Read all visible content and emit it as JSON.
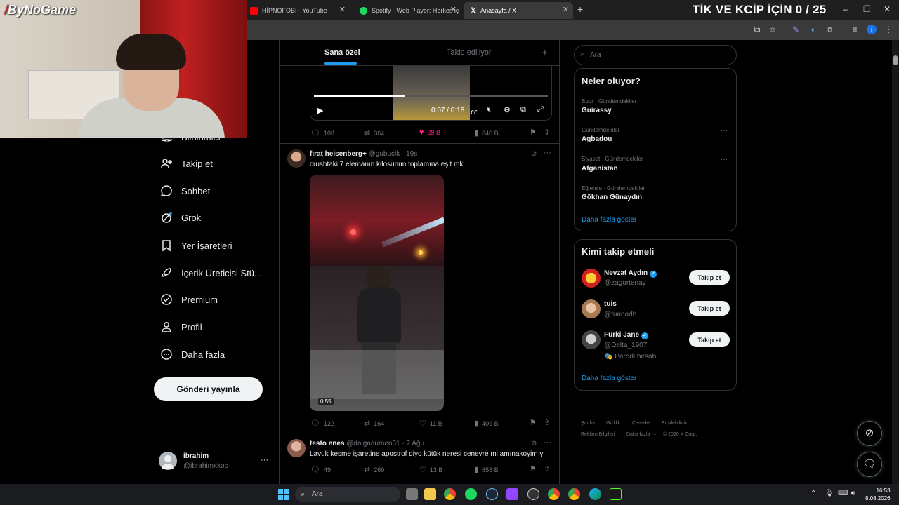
{
  "browser": {
    "tabs": [
      {
        "title": "HİPNOFOBİ - YouTube",
        "icon": "youtube-icon"
      },
      {
        "title": "Spotify - Web Player: Herkes iç",
        "icon": "spotify-icon"
      },
      {
        "title": "Anasayfa / X",
        "icon": "x-logo-icon"
      }
    ],
    "new_tab": "+",
    "window_controls": [
      "–",
      "❐",
      "✕"
    ]
  },
  "stream_overlay": {
    "logo": "ByNoGame",
    "counter": "TİK VE KCİP İÇİN 0 / 25"
  },
  "sidebar": {
    "items": [
      {
        "label": "Bildirimler",
        "icon": "bell-icon"
      },
      {
        "label": "Takip et",
        "icon": "person-plus-icon"
      },
      {
        "label": "Sohbet",
        "icon": "chat-bubble-icon"
      },
      {
        "label": "Grok",
        "icon": "grok-icon"
      },
      {
        "label": "Yer İşaretleri",
        "icon": "bookmark-icon"
      },
      {
        "label": "İçerik Üreticisi Stü...",
        "icon": "rocket-icon"
      },
      {
        "label": "Premium",
        "icon": "premium-check-icon"
      },
      {
        "label": "Profil",
        "icon": "person-icon"
      },
      {
        "label": "Daha fazla",
        "icon": "more-circle-icon"
      }
    ],
    "post_button": "Gönderi yayınla",
    "account": {
      "name": "ibrahim",
      "handle": "@ibrahimxkoc",
      "more": "···"
    }
  },
  "feed": {
    "tabs": [
      "Sana özel",
      "Takip ediliyor"
    ],
    "add_tab": "+",
    "video_player": {
      "time": "0:07 / 0:18",
      "progress": 0.39
    },
    "tweets": [
      {
        "metrics": {
          "replies": "108",
          "reposts": "364",
          "likes": "28 B",
          "views": "840 B"
        }
      },
      {
        "name": "fırat heisenberg+",
        "handle": "@gubucik",
        "time": "· 19s",
        "text": "crushtaki 7 elemanın kilosunun toplamına eşit mk",
        "media_duration": "0:55",
        "metrics": {
          "replies": "122",
          "reposts": "164",
          "likes": "11 B",
          "views": "409 B"
        }
      },
      {
        "name": "testo enes",
        "handle": "@dalgadumen31",
        "time": "· 7 Ağu",
        "text": "Lavuk kesme işaretine apostrof diyo kütük neresi cenevre mi amınakoyim y",
        "metrics": {
          "replies": "49",
          "reposts": "269",
          "likes": "13 B",
          "views": "658 B"
        }
      }
    ]
  },
  "right": {
    "search_placeholder": "Ara",
    "trends": {
      "title": "Neler oluyor?",
      "items": [
        {
          "meta": "Spor · Gündemdekiler",
          "name": "Guirassy"
        },
        {
          "meta": "Gündemdekiler",
          "name": "Agbadou"
        },
        {
          "meta": "Siyaset · Gündemdekiler",
          "name": "Afganistan"
        },
        {
          "meta": "Eğlence · Gündemdekiler",
          "name": "Gökhan Günaydın"
        }
      ],
      "show_more": "Daha fazla göster"
    },
    "who_to_follow": {
      "title": "Kimi takip etmeli",
      "items": [
        {
          "name": "Nevzat Aydın",
          "handle": "@zagortenay",
          "verified": true,
          "button": "Takip et"
        },
        {
          "name": "tuis",
          "handle": "@tuanadb",
          "verified": false,
          "button": "Takip et"
        },
        {
          "name": "Furki Jane",
          "handle": "@Delta_1907",
          "verified": true,
          "note": "🎭 Parodi hesabı",
          "button": "Takip et"
        }
      ],
      "show_more": "Daha fazla göster"
    },
    "footer": [
      "Şartlar",
      "Gizlilik",
      "Çerezler",
      "Erişilebilirlik",
      "Reklam Bilgileri",
      "Daha fazla ···",
      "© 2026 X Corp."
    ]
  },
  "taskbar": {
    "search": "Ara",
    "clock_time": "16:53",
    "clock_date": "8.08.2026"
  },
  "colors": {
    "accent": "#1d9bf0",
    "like": "#f91880",
    "bg": "#000000",
    "border": "#2f3336"
  }
}
